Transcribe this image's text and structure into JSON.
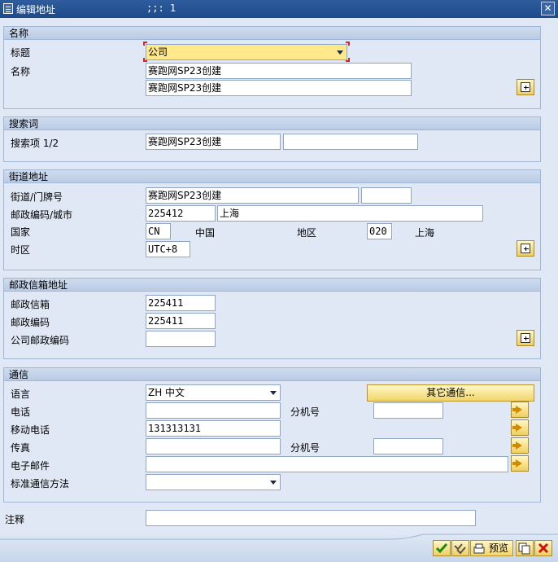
{
  "window": {
    "title": "编辑地址",
    "subtitle": ";;: 1",
    "close": "✕"
  },
  "name_group": {
    "header": "名称",
    "title_label": "标题",
    "title_value": "公司",
    "name_label": "名称",
    "name1": "赛跑网SP23创建",
    "name2": "赛跑网SP23创建"
  },
  "search_group": {
    "header": "搜索词",
    "label": "搜索项 1/2",
    "term1": "赛跑网SP23创建",
    "term2": ""
  },
  "street_group": {
    "header": "街道地址",
    "street_label": "街道/门牌号",
    "street": "赛跑网SP23创建",
    "house_no": "",
    "postal_city_label": "邮政编码/城市",
    "postal": "225412",
    "city": "上海",
    "country_label": "国家",
    "country_code": "CN",
    "country_name": "中国",
    "region_label": "地区",
    "region_code": "020",
    "region_name": "上海",
    "timezone_label": "时区",
    "timezone": "UTC+8"
  },
  "pobox_group": {
    "header": "邮政信箱地址",
    "pobox_label": "邮政信箱",
    "pobox": "225411",
    "postal_label": "邮政编码",
    "postal": "225411",
    "company_postal_label": "公司邮政编码",
    "company_postal": ""
  },
  "comm_group": {
    "header": "通信",
    "language_label": "语言",
    "language": "ZH 中文",
    "other_comm_button": "其它通信...",
    "phone_label": "电话",
    "phone": "",
    "ext_label": "分机号",
    "phone_ext": "",
    "mobile_label": "移动电话",
    "mobile": "131313131",
    "fax_label": "传真",
    "fax": "",
    "fax_ext": "",
    "email_label": "电子邮件",
    "email": "",
    "std_comm_label": "标准通信方法",
    "std_comm": ""
  },
  "notes": {
    "label": "注释",
    "value": ""
  },
  "footer": {
    "preview_button": "预览"
  },
  "colors": {
    "title_bar": "#1d4a8a",
    "highlight_field": "#ffe98a",
    "button": "#f1d56a",
    "background": "#dfe8f4"
  }
}
